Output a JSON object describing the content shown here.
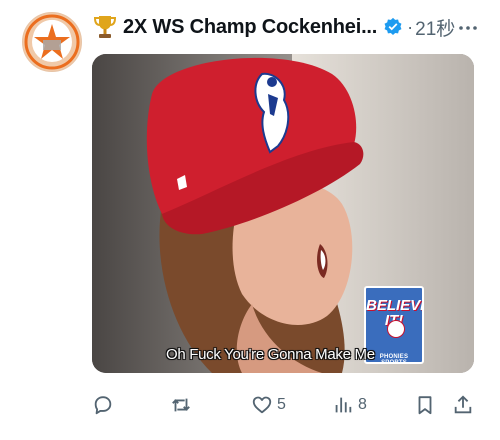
{
  "tweet": {
    "author_badge_icon": "trophy-icon",
    "author_name": "2X WS Champ Cockenhei...",
    "verified_icon": "verified-badge-icon",
    "separator": "·",
    "timestamp": "21秒",
    "more_icon": "more-horizontal-icon"
  },
  "media": {
    "caption": "Oh Fuck You're Gonna Make Me",
    "logo_line1": "BELIEVE IT!",
    "logo_line2": "PHONIES SPORTS"
  },
  "actions": {
    "reply": {
      "icon": "reply-icon",
      "count": ""
    },
    "retweet": {
      "icon": "retweet-icon",
      "count": ""
    },
    "like": {
      "icon": "heart-icon",
      "count": "5"
    },
    "views": {
      "icon": "views-icon",
      "count": "8"
    },
    "bookmark": {
      "icon": "bookmark-icon",
      "count": ""
    },
    "share": {
      "icon": "share-icon",
      "count": ""
    }
  },
  "colors": {
    "accent": "#1d9bf0",
    "muted": "#536471",
    "cap_red": "#c8102e"
  }
}
